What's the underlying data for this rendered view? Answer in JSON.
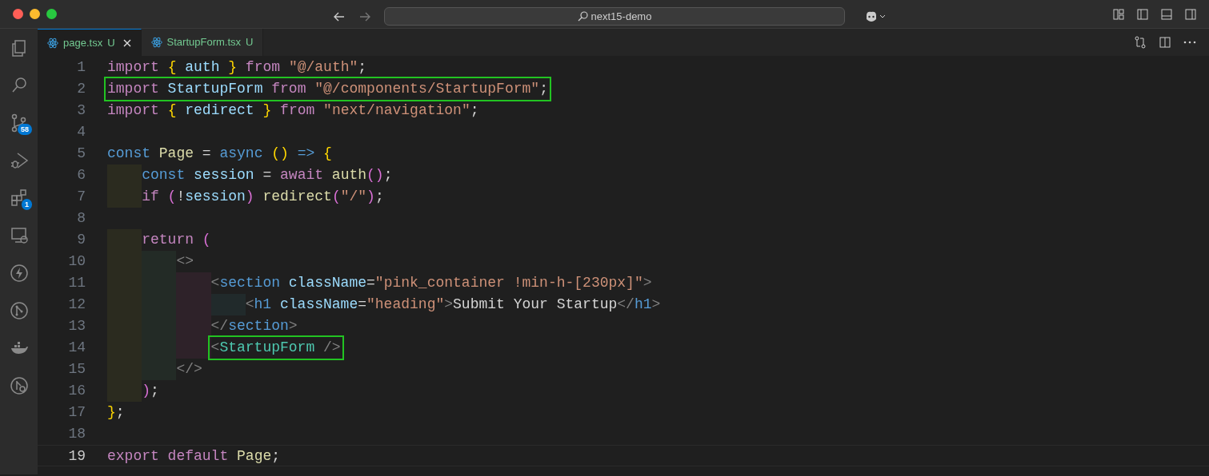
{
  "window": {
    "title": "next15-demo"
  },
  "activity_bar": {
    "source_control_badge": "58",
    "extensions_badge": "1"
  },
  "tabs": [
    {
      "label": "page.tsx",
      "status": "U",
      "selected": true
    },
    {
      "label": "StartupForm.tsx",
      "status": "U",
      "selected": false
    }
  ],
  "editor": {
    "lines": [
      {
        "number": "1",
        "boxed": false,
        "current": false,
        "tokens": [
          {
            "kind": "keyword",
            "text": "import "
          },
          {
            "kind": "brace",
            "text": "{"
          },
          {
            "kind": "var",
            "text": " auth "
          },
          {
            "kind": "brace",
            "text": "}"
          },
          {
            "kind": "keyword",
            "text": " from "
          },
          {
            "kind": "string",
            "text": "\"@/auth\""
          },
          {
            "kind": "text",
            "text": ";"
          }
        ]
      },
      {
        "number": "2",
        "boxed": true,
        "current": false,
        "tokens": [
          {
            "kind": "keyword",
            "text": "import"
          },
          {
            "kind": "var",
            "text": " StartupForm "
          },
          {
            "kind": "keyword",
            "text": "from "
          },
          {
            "kind": "string",
            "text": "\"@/components/StartupForm\""
          },
          {
            "kind": "text",
            "text": ";"
          }
        ]
      },
      {
        "number": "3",
        "boxed": false,
        "current": false,
        "tokens": [
          {
            "kind": "keyword",
            "text": "import "
          },
          {
            "kind": "brace",
            "text": "{"
          },
          {
            "kind": "var",
            "text": " redirect "
          },
          {
            "kind": "brace",
            "text": "}"
          },
          {
            "kind": "keyword",
            "text": " from "
          },
          {
            "kind": "string",
            "text": "\"next/navigation\""
          },
          {
            "kind": "text",
            "text": ";"
          }
        ]
      },
      {
        "number": "4",
        "boxed": false,
        "current": false
      },
      {
        "number": "5",
        "boxed": false,
        "current": false,
        "tokens": [
          {
            "kind": "storage",
            "text": "const"
          },
          {
            "kind": "func",
            "text": " Page"
          },
          {
            "kind": "text",
            "text": " = "
          },
          {
            "kind": "storage",
            "text": "async "
          },
          {
            "kind": "brace",
            "text": "()"
          },
          {
            "kind": "storage",
            "text": " => "
          },
          {
            "kind": "brace",
            "text": "{"
          }
        ],
        "children": [
          {
            "number": "6",
            "boxed": false,
            "current": false,
            "tokens": [
              {
                "kind": "storage",
                "text": "const"
              },
              {
                "kind": "var",
                "text": " session"
              },
              {
                "kind": "text",
                "text": " = "
              },
              {
                "kind": "keyword",
                "text": "await"
              },
              {
                "kind": "func",
                "text": " auth"
              },
              {
                "kind": "paren",
                "text": "()"
              },
              {
                "kind": "text",
                "text": ";"
              }
            ]
          },
          {
            "number": "7",
            "boxed": false,
            "current": false,
            "tokens": [
              {
                "kind": "keyword",
                "text": "if "
              },
              {
                "kind": "paren",
                "text": "("
              },
              {
                "kind": "text",
                "text": "!"
              },
              {
                "kind": "var",
                "text": "session"
              },
              {
                "kind": "paren",
                "text": ")"
              },
              {
                "kind": "func",
                "text": " redirect"
              },
              {
                "kind": "paren",
                "text": "("
              },
              {
                "kind": "string",
                "text": "\"/\""
              },
              {
                "kind": "paren",
                "text": ")"
              },
              {
                "kind": "text",
                "text": ";"
              }
            ]
          },
          {
            "number": "8",
            "boxed": false,
            "current": false
          },
          {
            "number": "9",
            "boxed": false,
            "current": false,
            "tokens": [
              {
                "kind": "keyword",
                "text": "return "
              },
              {
                "kind": "paren",
                "text": "("
              }
            ],
            "children": [
              {
                "number": "10",
                "boxed": false,
                "current": false,
                "tokens": [
                  {
                    "kind": "punct",
                    "text": "<>"
                  }
                ],
                "children": [
                  {
                    "number": "11",
                    "boxed": false,
                    "current": false,
                    "tokens": [
                      {
                        "kind": "punct",
                        "text": "<"
                      },
                      {
                        "kind": "tag",
                        "text": "section"
                      },
                      {
                        "kind": "attr",
                        "text": " className"
                      },
                      {
                        "kind": "text",
                        "text": "="
                      },
                      {
                        "kind": "string",
                        "text": "\"pink_container !min-h-[230px]\""
                      },
                      {
                        "kind": "punct",
                        "text": ">"
                      }
                    ],
                    "children": [
                      {
                        "number": "12",
                        "boxed": false,
                        "current": false,
                        "tokens": [
                          {
                            "kind": "punct",
                            "text": "<"
                          },
                          {
                            "kind": "tag",
                            "text": "h1"
                          },
                          {
                            "kind": "attr",
                            "text": " className"
                          },
                          {
                            "kind": "text",
                            "text": "="
                          },
                          {
                            "kind": "string",
                            "text": "\"heading\""
                          },
                          {
                            "kind": "punct",
                            "text": ">"
                          },
                          {
                            "kind": "text",
                            "text": "Submit Your Startup"
                          },
                          {
                            "kind": "punct",
                            "text": "</"
                          },
                          {
                            "kind": "tag",
                            "text": "h1"
                          },
                          {
                            "kind": "punct",
                            "text": ">"
                          }
                        ]
                      }
                    ]
                  },
                  {
                    "number": "13",
                    "boxed": false,
                    "current": false,
                    "tokens": [
                      {
                        "kind": "punct",
                        "text": "</"
                      },
                      {
                        "kind": "tag",
                        "text": "section"
                      },
                      {
                        "kind": "punct",
                        "text": ">"
                      }
                    ]
                  },
                  {
                    "number": "14",
                    "boxed": true,
                    "current": false,
                    "tokens": [
                      {
                        "kind": "punct",
                        "text": "<"
                      },
                      {
                        "kind": "component",
                        "text": "StartupForm"
                      },
                      {
                        "kind": "punct",
                        "text": " />"
                      }
                    ]
                  }
                ]
              },
              {
                "number": "15",
                "boxed": false,
                "current": false,
                "tokens": [
                  {
                    "kind": "punct",
                    "text": "</>"
                  }
                ]
              }
            ]
          },
          {
            "number": "16",
            "boxed": false,
            "current": false,
            "tokens": [
              {
                "kind": "paren",
                "text": ")"
              },
              {
                "kind": "text",
                "text": ";"
              }
            ]
          }
        ]
      },
      {
        "number": "17",
        "boxed": false,
        "current": false,
        "tokens": [
          {
            "kind": "brace",
            "text": "}"
          },
          {
            "kind": "text",
            "text": ";"
          }
        ]
      },
      {
        "number": "18",
        "boxed": false,
        "current": false
      },
      {
        "number": "19",
        "boxed": false,
        "current": true,
        "tokens": [
          {
            "kind": "keyword",
            "text": "export default"
          },
          {
            "kind": "func",
            "text": " Page"
          },
          {
            "kind": "text",
            "text": ";"
          }
        ]
      }
    ]
  }
}
